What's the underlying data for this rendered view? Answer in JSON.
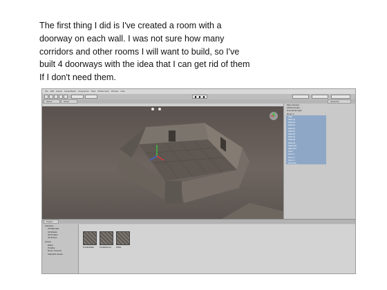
{
  "slide": {
    "lines": [
      "The first thing I did is I've created a room with a",
      "doorway on each wall. I was not sure how many",
      "corridors and other rooms  I will want to build, so I've",
      "built 4 doorways with the idea that I can get rid of them",
      "If I don't need them."
    ]
  },
  "editor": {
    "menu": [
      "File",
      "Edit",
      "Assets",
      "GameObject",
      "Component",
      "Tools",
      "Mobile Input",
      "Window",
      "Help"
    ],
    "scene_tab": "Scene",
    "game_tab": "Game",
    "hierarchy_tab": "Hierarchy",
    "project_tab": "Project",
    "hierarchy_items": [
      "Main Camera",
      "FPSController",
      "Directional Light",
      "Room 1",
      "Wall",
      "Wall (1)",
      "Wall (2)",
      "Wall (3)",
      "Wall (4)",
      "Wall (5)",
      "Wall (6)",
      "Wall (7)",
      "Wall (8)",
      "Wall (9)",
      "Wall (10)",
      "Wall (11)",
      "Floor",
      "Floor 1",
      "Floor 2",
      "Floor 3",
      "Doorway"
    ],
    "selected_from": 4,
    "project_tree": [
      "Favorites",
      "All Materials",
      "All Models",
      "All Prefabs",
      "All Scripts",
      "Assets",
      "Editor",
      "Prefabs",
      "Room Textures",
      "Standard Assets"
    ],
    "assets": [
      "PrefabWalls",
      "PrefabFloors",
      "Walls"
    ],
    "colors": {
      "scene_bg": "#6e6560",
      "selection": "#8ea7c6",
      "wall_stone": "#6f6760"
    }
  }
}
